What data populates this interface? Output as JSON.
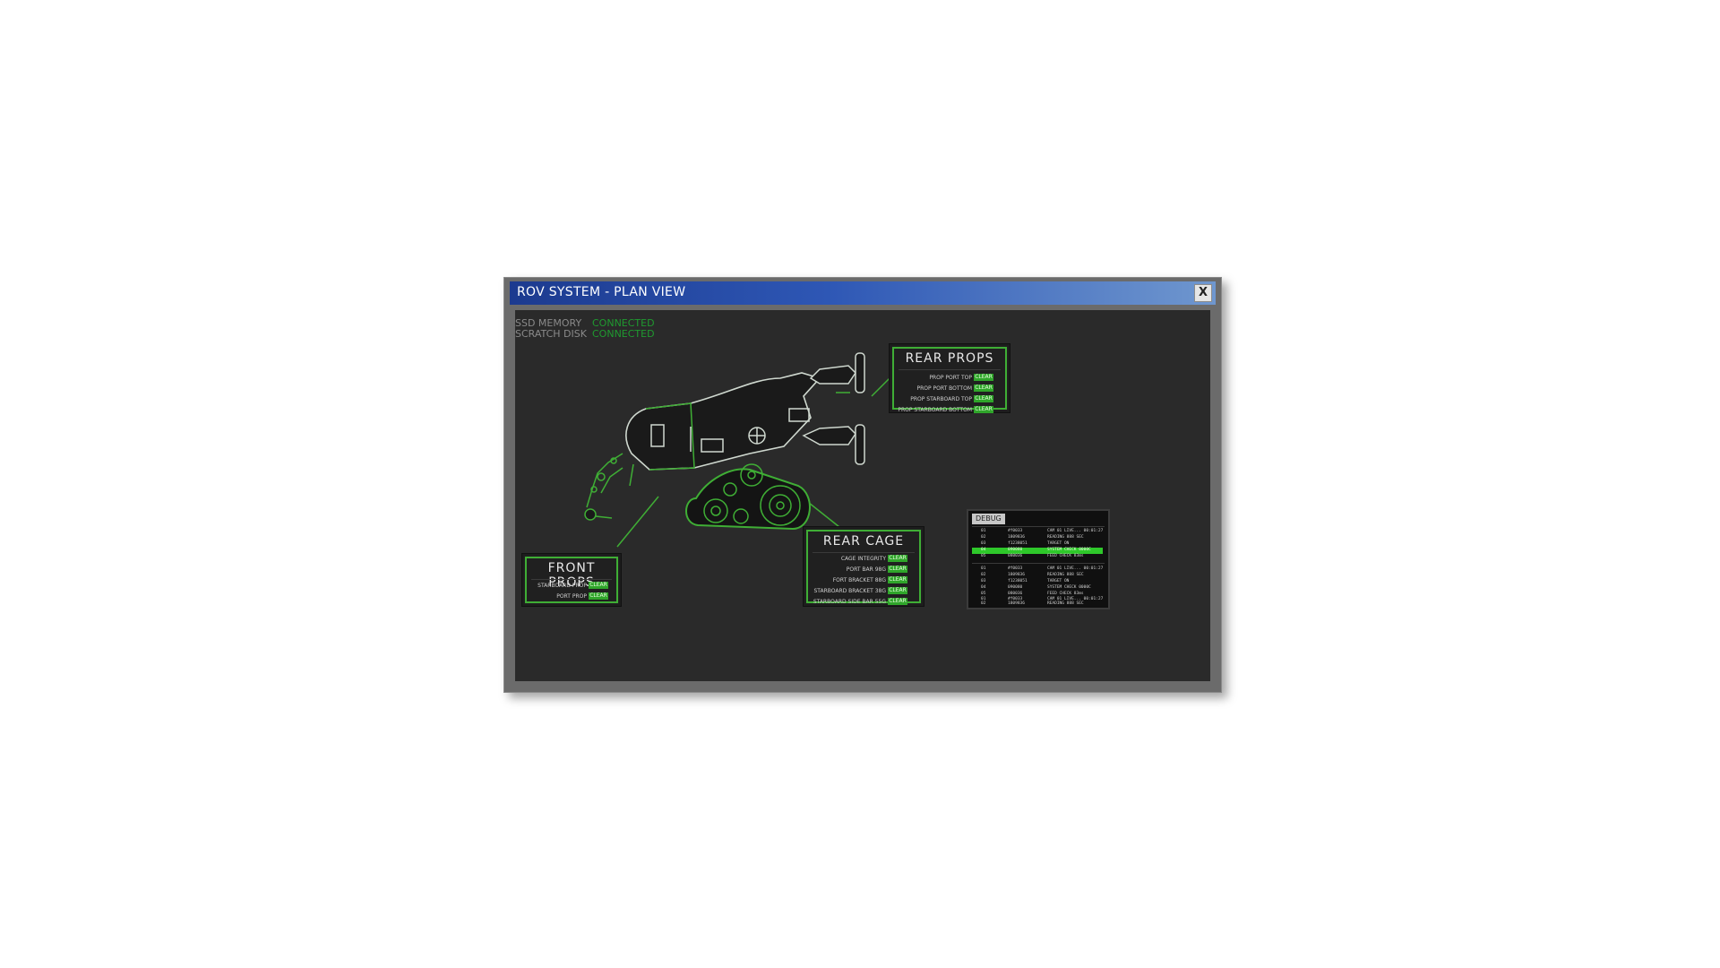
{
  "window": {
    "title": "ROV SYSTEM - PLAN VIEW",
    "close_label": "X"
  },
  "status": {
    "rows": [
      {
        "label": "SSD MEMORY",
        "value": "CONNECTED"
      },
      {
        "label": "SCRATCH DISK",
        "value": "CONNECTED"
      }
    ]
  },
  "panels": {
    "rear_props": {
      "title": "REAR PROPS",
      "rows": [
        {
          "label": "PROP PORT TOP",
          "status": "CLEAR"
        },
        {
          "label": "PROP PORT BOTTOM",
          "status": "CLEAR"
        },
        {
          "label": "PROP STARBOARD TOP",
          "status": "CLEAR"
        },
        {
          "label": "PROP STARBOARD BOTTOM",
          "status": "CLEAR"
        }
      ]
    },
    "rear_cage": {
      "title": "REAR CAGE",
      "rows": [
        {
          "label": "CAGE INTEGRITY",
          "status": "CLEAR"
        },
        {
          "label": "PORT BAR 98G",
          "status": "CLEAR"
        },
        {
          "label": "FORT BRACKET 88G",
          "status": "CLEAR"
        },
        {
          "label": "STARBOARD BRACKET 38G",
          "status": "CLEAR"
        },
        {
          "label": "STARBOARD SIDE BAR 55G",
          "status": "CLEAR"
        }
      ]
    },
    "front_props": {
      "title": "FRONT PROPS",
      "rows": [
        {
          "label": "STARBOARD PROP",
          "status": "CLEAR"
        },
        {
          "label": "PORT PROP",
          "status": "CLEAR"
        }
      ]
    }
  },
  "debug": {
    "tab_label": "DEBUG",
    "groups": [
      [
        {
          "id": "01",
          "code": "#f0033",
          "msg": "CAM 01 LIVE... 00:01:27"
        },
        {
          "id": "02",
          "code": "1809836",
          "msg": "READING 888 SEC"
        },
        {
          "id": "03",
          "code": "f1238051",
          "msg": "TARGET ON"
        },
        {
          "id": "04",
          "code": "090080",
          "msg": "SYSTEM CHECK 0000C",
          "highlight": true
        },
        {
          "id": "05",
          "code": "080036",
          "msg": "FEED CHECK 83ms"
        }
      ],
      [
        {
          "id": "01",
          "code": "#f0033",
          "msg": "CAM 01 LIVE... 00:01:27"
        },
        {
          "id": "02",
          "code": "1809836",
          "msg": "READING 888 SEC"
        },
        {
          "id": "03",
          "code": "f1238051",
          "msg": "TARGET ON"
        },
        {
          "id": "04",
          "code": "090080",
          "msg": "SYSTEM CHECK 0000C"
        },
        {
          "id": "05",
          "code": "080036",
          "msg": "FEED CHECK 83ms"
        }
      ],
      [
        {
          "id": "01",
          "code": "#f0033",
          "msg": "CAM 01 LIVE... 00:01:27"
        },
        {
          "id": "02",
          "code": "1809836",
          "msg": "READING 888 SEC"
        }
      ]
    ]
  },
  "colors": {
    "accent": "#3fae35",
    "connected": "#1f9a2f",
    "title_bar": "#2e57b5"
  }
}
